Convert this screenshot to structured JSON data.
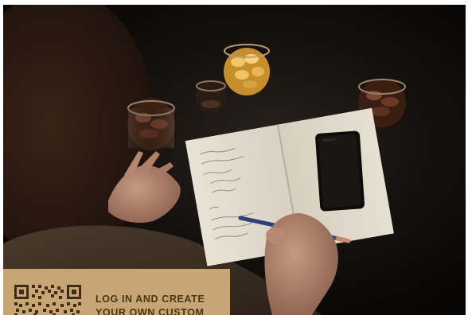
{
  "promo": {
    "line1": "LOG IN AND CREATE",
    "line2": "YOUR OWN CUSTOM"
  },
  "colors": {
    "background": "#0c0a09",
    "promo_banner": "#c7a574",
    "promo_text": "#4a3418",
    "notebook_page": "#e9e3d6",
    "pencil": "#2f3f7a"
  },
  "icons": [
    "qr-code"
  ]
}
